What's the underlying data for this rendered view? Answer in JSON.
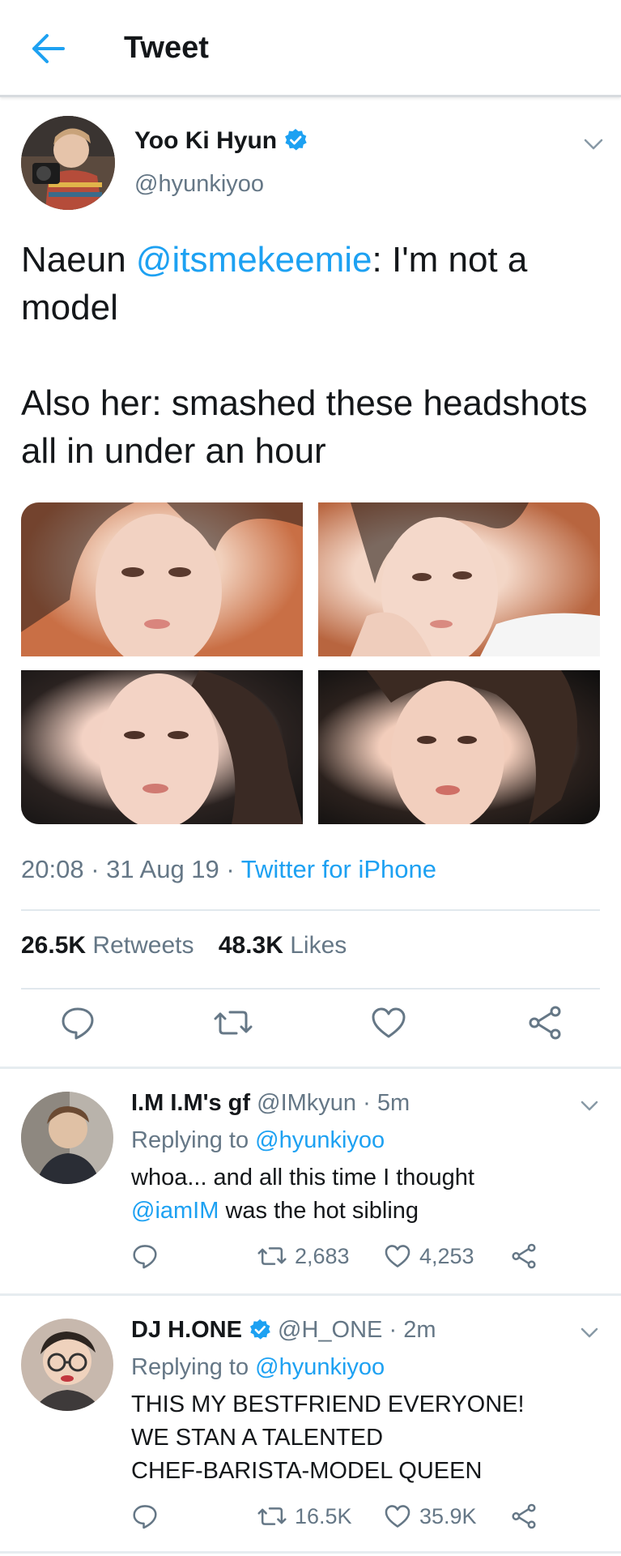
{
  "header": {
    "title": "Tweet",
    "back_icon": "back-arrow-icon"
  },
  "colors": {
    "accent": "#1da1f2",
    "text": "#14171a",
    "secondary": "#657786",
    "divider": "#e1e8ed"
  },
  "tweet": {
    "author": {
      "name": "Yoo Ki Hyun",
      "handle": "@hyunkiyoo",
      "verified": true
    },
    "text": {
      "prefix": "Naeun ",
      "mention": "@itsmekeemie",
      "rest": ": I'm not a model\n\nAlso her: smashed these headshots all in under an hour"
    },
    "media_count": 4,
    "time": "20:08",
    "date": "31 Aug 19",
    "source": "Twitter for iPhone",
    "retweets": {
      "count": "26.5K",
      "label": "Retweets"
    },
    "likes": {
      "count": "48.3K",
      "label": "Likes"
    },
    "actions": [
      "reply-icon",
      "retweet-icon",
      "like-icon",
      "share-icon"
    ]
  },
  "replies": [
    {
      "name": "I.M I.M's gf",
      "handle": "@IMkyun",
      "time": "5m",
      "verified": false,
      "replying_prefix": "Replying to",
      "replying_handle": "@hyunkiyoo",
      "text_before": "whoa... and all this time I thought\n",
      "text_mention": "@iamIM",
      "text_after": " was the hot sibling",
      "retweets": "2,683",
      "likes": "4,253"
    },
    {
      "name": "DJ H.ONE",
      "handle": "@H_ONE",
      "time": "2m",
      "verified": true,
      "replying_prefix": "Replying to",
      "replying_handle": "@hyunkiyoo",
      "text_before": "THIS MY BESTFRIEND EVERYONE!\nWE STAN A TALENTED\nCHEF-BARISTA-MODEL QUEEN",
      "text_mention": "",
      "text_after": "",
      "retweets": "16.5K",
      "likes": "35.9K"
    }
  ]
}
